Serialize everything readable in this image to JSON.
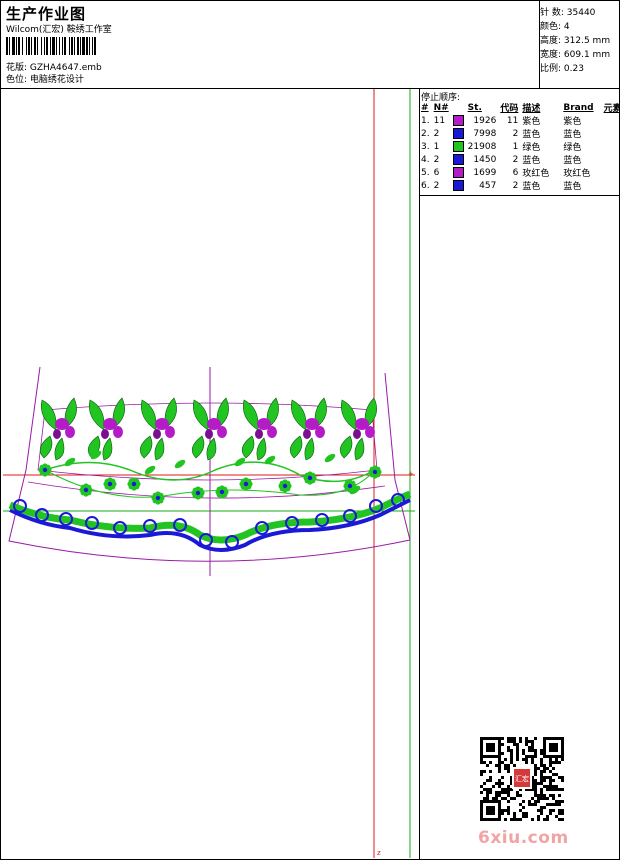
{
  "header": {
    "title": "生产作业图",
    "studio": "Wilcom(汇宏) 鞍绣工作室",
    "file_label": "花版:",
    "file_value": "GZHA4647.emb",
    "color_label": "色位:",
    "color_value": "电脑绣花设计"
  },
  "stats": [
    {
      "label": "针 数:",
      "value": "35440"
    },
    {
      "label": "颜色:",
      "value": "4"
    },
    {
      "label": "高度:",
      "value": "312.5 mm"
    },
    {
      "label": "宽度:",
      "value": "609.1 mm"
    },
    {
      "label": "比例:",
      "value": "0.23"
    }
  ],
  "thread_table": {
    "title": "停止顺序:",
    "headers": [
      "#",
      "N#",
      "St.",
      "代码",
      "描述",
      "Brand",
      "元素"
    ],
    "rows": [
      {
        "idx": "1.",
        "n": "11",
        "st": "1926",
        "code": "11",
        "desc": "紫色",
        "brand": "紫色",
        "color": "#b31cc7"
      },
      {
        "idx": "2.",
        "n": "2",
        "st": "7998",
        "code": "2",
        "desc": "蓝色",
        "brand": "蓝色",
        "color": "#1a1ad6"
      },
      {
        "idx": "3.",
        "n": "1",
        "st": "21908",
        "code": "1",
        "desc": "绿色",
        "brand": "绿色",
        "color": "#22c422"
      },
      {
        "idx": "4.",
        "n": "2",
        "st": "1450",
        "code": "2",
        "desc": "蓝色",
        "brand": "蓝色",
        "color": "#1a1ad6"
      },
      {
        "idx": "5.",
        "n": "6",
        "st": "1699",
        "code": "6",
        "desc": "玫红色",
        "brand": "玫红色",
        "color": "#b31cc7"
      },
      {
        "idx": "6.",
        "n": "2",
        "st": "457",
        "code": "2",
        "desc": "蓝色",
        "brand": "蓝色",
        "color": "#1a1ad6"
      }
    ]
  },
  "colors": {
    "purple": "#b31cc7",
    "blue": "#1a1ad6",
    "green": "#22c422",
    "guide_red": "#e01818",
    "guide_green": "#1aa81a",
    "outline_violet": "#9a1aa8"
  },
  "watermark": {
    "text": "6xiu.com",
    "seal": "汇宏"
  }
}
